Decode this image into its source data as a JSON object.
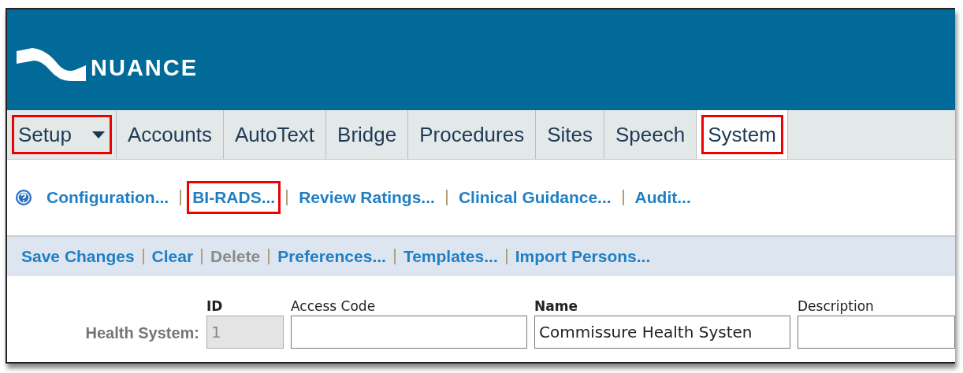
{
  "header": {
    "logo": "NUANCE"
  },
  "tabs": [
    {
      "label": "Setup",
      "kind": "menu",
      "selected": false,
      "highlighted": true
    },
    {
      "label": "Accounts",
      "kind": "tab",
      "selected": false,
      "highlighted": false
    },
    {
      "label": "AutoText",
      "kind": "tab",
      "selected": false,
      "highlighted": false
    },
    {
      "label": "Bridge",
      "kind": "tab",
      "selected": false,
      "highlighted": false
    },
    {
      "label": "Procedures",
      "kind": "tab",
      "selected": false,
      "highlighted": false
    },
    {
      "label": "Sites",
      "kind": "tab",
      "selected": false,
      "highlighted": false
    },
    {
      "label": "Speech",
      "kind": "tab",
      "selected": false,
      "highlighted": false
    },
    {
      "label": "System",
      "kind": "tab",
      "selected": true,
      "highlighted": true
    }
  ],
  "sub_links": [
    {
      "label": "Configuration...",
      "highlighted": false
    },
    {
      "label": "BI-RADS...",
      "highlighted": true
    },
    {
      "label": "Review Ratings...",
      "highlighted": false
    },
    {
      "label": "Clinical Guidance...",
      "highlighted": false
    },
    {
      "label": "Audit...",
      "highlighted": false
    }
  ],
  "actions": [
    {
      "label": "Save Changes",
      "disabled": false
    },
    {
      "label": "Clear",
      "disabled": false
    },
    {
      "label": "Delete",
      "disabled": true
    },
    {
      "label": "Preferences...",
      "disabled": false
    },
    {
      "label": "Templates...",
      "disabled": false
    },
    {
      "label": "Import Persons...",
      "disabled": false
    }
  ],
  "form": {
    "row_label": "Health System:",
    "fields": [
      {
        "label": "ID",
        "value": "1",
        "required": true,
        "disabled": true
      },
      {
        "label": "Access Code",
        "required": false,
        "disabled": false
      },
      {
        "label": "Name",
        "value": "Commissure Health Systen",
        "required": true,
        "disabled": false
      },
      {
        "label": "Description",
        "required": false,
        "disabled": false
      }
    ]
  }
}
